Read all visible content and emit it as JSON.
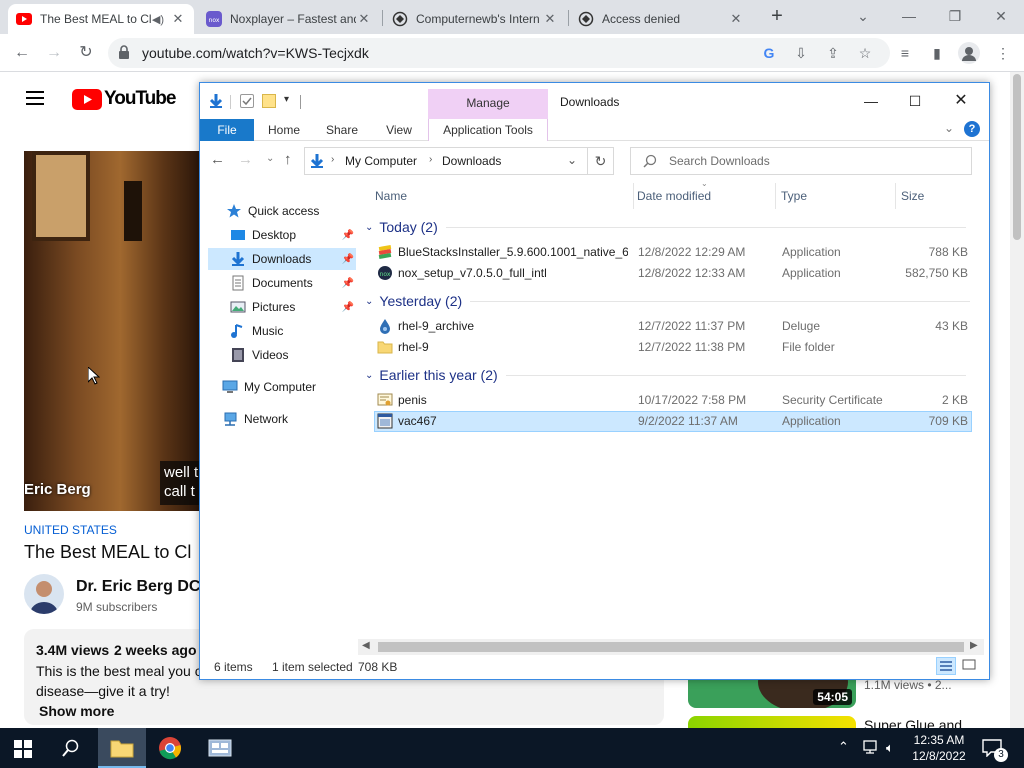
{
  "browser": {
    "tabs": [
      {
        "title": "The Best MEAL to Cl",
        "favicon": "youtube-icon",
        "active": true
      },
      {
        "title": "Noxplayer – Fastest and",
        "favicon": "nox-icon",
        "active": false
      },
      {
        "title": "Computernewb's Intern",
        "favicon": "vm-icon",
        "active": false
      },
      {
        "title": "Access denied",
        "favicon": "vm-icon",
        "active": false
      }
    ],
    "url": "youtube.com/watch?v=KWS-Tecjxdk"
  },
  "youtube": {
    "logo_text": "YouTube",
    "video_overlay_name": "Eric Berg",
    "video_caption": "well t\ncall t",
    "location_tag": "UNITED STATES",
    "video_title": "The Best MEAL to Cl",
    "channel_name": "Dr. Eric Berg DC",
    "subscribers": "9M subscribers",
    "views": "3.4M views",
    "age": "2 weeks ago",
    "description_line1": "This is the best meal you c",
    "description_line2": "disease—give it a try!",
    "show_more": "Show more",
    "related": [
      {
        "duration": "54:05",
        "meta": "1.1M views  •  2..."
      },
      {
        "title": "Super Glue and"
      }
    ]
  },
  "explorer": {
    "window_title": "Downloads",
    "context_tab": "Manage",
    "ribbon_tabs": [
      "File",
      "Home",
      "Share",
      "View",
      "Application Tools"
    ],
    "breadcrumb": [
      "My Computer",
      "Downloads"
    ],
    "search_placeholder": "Search Downloads",
    "columns": {
      "name": "Name",
      "date": "Date modified",
      "type": "Type",
      "size": "Size"
    },
    "nav": {
      "quick_access": "Quick access",
      "items": [
        "Desktop",
        "Downloads",
        "Documents",
        "Pictures",
        "Music",
        "Videos"
      ],
      "my_computer": "My Computer",
      "network": "Network"
    },
    "groups": [
      {
        "label": "Today (2)",
        "files": [
          {
            "name": "BlueStacksInstaller_5.9.600.1001_native_6...",
            "date": "12/8/2022 12:29 AM",
            "type": "Application",
            "size": "788 KB",
            "icon": "bluestacks-icon"
          },
          {
            "name": "nox_setup_v7.0.5.0_full_intl",
            "date": "12/8/2022 12:33 AM",
            "type": "Application",
            "size": "582,750 KB",
            "icon": "nox-icon"
          }
        ]
      },
      {
        "label": "Yesterday (2)",
        "files": [
          {
            "name": "rhel-9_archive",
            "date": "12/7/2022 11:37 PM",
            "type": "Deluge",
            "size": "43 KB",
            "icon": "deluge-icon"
          },
          {
            "name": "rhel-9",
            "date": "12/7/2022 11:38 PM",
            "type": "File folder",
            "size": "",
            "icon": "folder-icon"
          }
        ]
      },
      {
        "label": "Earlier this year (2)",
        "files": [
          {
            "name": "penis",
            "date": "10/17/2022 7:58 PM",
            "type": "Security Certificate",
            "size": "2 KB",
            "icon": "certificate-icon"
          },
          {
            "name": "vac467",
            "date": "9/2/2022 11:37 AM",
            "type": "Application",
            "size": "709 KB",
            "icon": "application-icon",
            "selected": true
          }
        ]
      }
    ],
    "status": {
      "items": "6 items",
      "selected": "1 item selected",
      "size": "708 KB"
    }
  },
  "taskbar": {
    "time": "12:35 AM",
    "date": "12/8/2022",
    "notifications": "3"
  },
  "colors": {
    "accent": "#0078d7",
    "youtube_red": "#ff0000",
    "selection": "#cce8ff",
    "taskbar": "#0b1726"
  }
}
